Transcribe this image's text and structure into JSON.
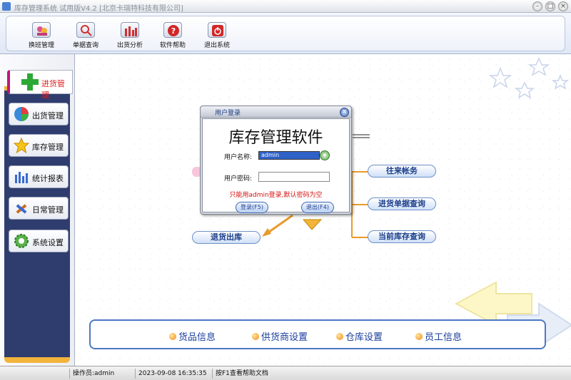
{
  "window": {
    "title": "库存管理系统 试用版V4.2 [北京卡瑞特科技有限公司]",
    "buttons": [
      "minimize-icon",
      "maximize-icon",
      "close-icon"
    ]
  },
  "toolbar": {
    "items": [
      {
        "label": "换班管理",
        "icon": "shift-change-icon"
      },
      {
        "label": "单据查询",
        "icon": "document-search-icon"
      },
      {
        "label": "出货分析",
        "icon": "bar-chart-icon"
      },
      {
        "label": "软件帮助",
        "icon": "help-icon"
      },
      {
        "label": "退出系统",
        "icon": "power-icon"
      }
    ]
  },
  "sidebar": {
    "active": {
      "label": "进货管理",
      "icon": "plus-icon"
    },
    "items": [
      {
        "label": "出货管理",
        "icon": "pie-chart-icon"
      },
      {
        "label": "库存管理",
        "icon": "star-icon"
      },
      {
        "label": "统计报表",
        "icon": "report-icon"
      },
      {
        "label": "日常管理",
        "icon": "tools-icon"
      },
      {
        "label": "系统设置",
        "icon": "gear-icon"
      }
    ]
  },
  "flow": {
    "return_out": "退货出库",
    "partners": "往来帐务",
    "purchase_query": "进货单据查询",
    "stock_query": "当前库存查询"
  },
  "bottom_links": [
    "货品信息",
    "供货商设置",
    "仓库设置",
    "员工信息"
  ],
  "status": {
    "operator": "操作员:admin",
    "datetime": "2023-09-08 16:35:35",
    "help": "按F1查看帮助文档"
  },
  "dialog": {
    "title": "用户登录",
    "heading": "库存管理软件",
    "username_label": "用户名称:",
    "username_value": "admin",
    "password_label": "用户密码:",
    "hint": "只能用admin登录,默认密码为空",
    "login_button": "登录(F5)",
    "exit_button": "退出(F4)"
  },
  "colors": {
    "accent": "#2f3c6e",
    "gold": "#f2b43b",
    "link": "#1a3e9e",
    "warning": "#d41010"
  }
}
